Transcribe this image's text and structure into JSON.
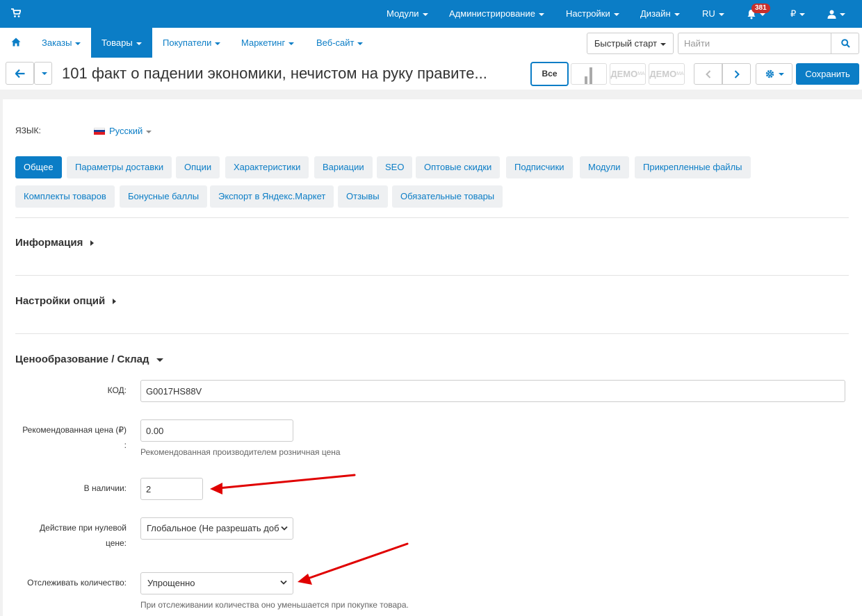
{
  "topbar": {
    "menus": [
      "Модули",
      "Администрирование",
      "Настройки",
      "Дизайн",
      "RU"
    ],
    "notifications_count": "381",
    "currency": "₽"
  },
  "nav": {
    "items": [
      "Заказы",
      "Товары",
      "Покупатели",
      "Маркетинг",
      "Веб-сайт"
    ],
    "active": "Товары",
    "quick_start": "Быстрый старт",
    "search_placeholder": "Найти"
  },
  "toolbar": {
    "title": "101 факт о падении экономики, нечистом на руку правите...",
    "view_all": "Все",
    "demo_label": "ДЕМО",
    "demo_small": "MA",
    "save_label": "Сохранить"
  },
  "language": {
    "label": "ЯЗЫК:",
    "value": "Русский"
  },
  "tabs": {
    "row1": [
      "Общее",
      "Параметры доставки",
      "Опции",
      "Характеристики",
      "Вариации",
      "SEO",
      "Оптовые скидки",
      "Подписчики",
      "Модули",
      "Прикрепленные файлы"
    ],
    "row2": [
      "Комплекты товаров",
      "Бонусные баллы",
      "Экспорт в Яндекс.Маркет",
      "Отзывы",
      "Обязательные товары"
    ],
    "active": "Общее"
  },
  "sections": {
    "info": "Информация",
    "options": "Настройки опций",
    "pricing": "Ценообразование / Склад"
  },
  "form": {
    "code_label": "КОД:",
    "code_value": "G0017HS88V",
    "rec_price_label": "Рекомендованная цена (₽)",
    "rec_price_colon": ":",
    "rec_price_value": "0.00",
    "rec_price_help": "Рекомендованная производителем розничная цена",
    "in_stock_label": "В наличии:",
    "in_stock_value": "2",
    "zero_price_label_1": "Действие при нулевой",
    "zero_price_label_2": "цене:",
    "zero_price_value": "Глобальное (Не разрешать доб",
    "track_label": "Отслеживать количество:",
    "track_value": "Упрощенно",
    "track_help": "При отслеживании количества оно уменьшается при покупке товара."
  },
  "colors": {
    "primary": "#0b7dc6",
    "annotation_arrow": "#e00000",
    "badge": "#c9302c"
  }
}
